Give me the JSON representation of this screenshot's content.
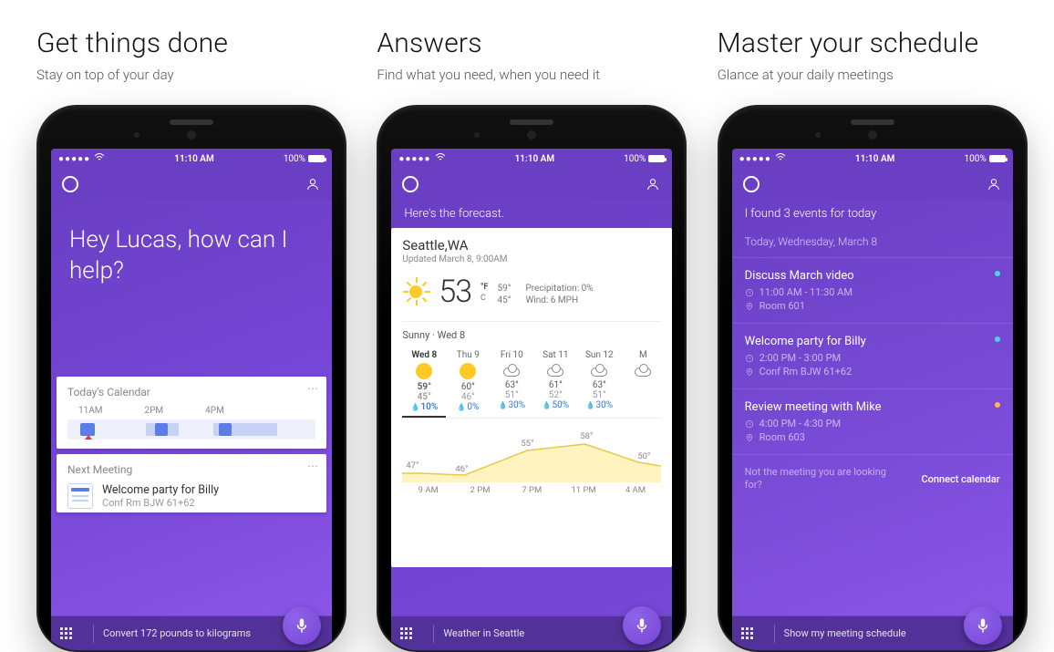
{
  "columns": {
    "c1": {
      "title": "Get things done",
      "subtitle": "Stay on top of your day"
    },
    "c2": {
      "title": "Answers",
      "subtitle": "Find what you need, when you need it"
    },
    "c3": {
      "title": "Master your schedule",
      "subtitle": "Glance at your daily meetings"
    }
  },
  "status": {
    "time": "11:10 AM",
    "battery_pct": "100%"
  },
  "screen1": {
    "greeting": "Hey Lucas, how can I help?",
    "today_calendar_label": "Today's Calendar",
    "timeline_labels": [
      "11AM",
      "2PM",
      "4PM"
    ],
    "next_meeting_label": "Next Meeting",
    "next_meeting_title": "Welcome party for Billy",
    "next_meeting_location": "Conf Rm BJW 61+62",
    "bottom_hint": "Convert 172 pounds to kilograms"
  },
  "screen2": {
    "caption": "Here's the forecast.",
    "location": "Seattle,WA",
    "updated": "Updated March 8, 9:00AM",
    "temp": "53",
    "unit_f": "°F",
    "unit_c": "C",
    "hi": "59°",
    "lo": "45°",
    "precip": "Precipitation: 0%",
    "wind": "Wind: 6 MPH",
    "condition_line": "Sunny  ·  Wed 8",
    "days": [
      {
        "label": "Wed 8",
        "icon": "sun",
        "hi": "59°",
        "lo": "45°",
        "rain": "10%"
      },
      {
        "label": "Thu 9",
        "icon": "sun",
        "hi": "60°",
        "lo": "46°",
        "rain": "0%"
      },
      {
        "label": "Fri 10",
        "icon": "cloud",
        "hi": "63°",
        "lo": "51°",
        "rain": "30%"
      },
      {
        "label": "Sat 11",
        "icon": "cloud",
        "hi": "61°",
        "lo": "52°",
        "rain": "50%"
      },
      {
        "label": "Sun 12",
        "icon": "cloud",
        "hi": "63°",
        "lo": "51°",
        "rain": "30%"
      },
      {
        "label": "M",
        "icon": "cloud",
        "hi": "",
        "lo": "",
        "rain": ""
      }
    ],
    "hourly_labels": [
      "9 AM",
      "2 PM",
      "7 PM",
      "11 PM",
      "4 AM"
    ],
    "hourly_points": [
      "47°",
      "46°",
      "55°",
      "58°",
      "50°"
    ],
    "bottom_hint": "Weather in Seattle"
  },
  "screen3": {
    "caption": "I found 3 events for today",
    "date_line": "Today, Wednesday, March 8",
    "events": [
      {
        "title": "Discuss March video",
        "time": "11:00 AM - 11:30 AM",
        "room": "Room 601",
        "dot": "#4ad7e6"
      },
      {
        "title": "Welcome party for Billy",
        "time": "2:00 PM - 3:00 PM",
        "room": "Conf Rm BJW 61+62",
        "dot": "#4ad7e6"
      },
      {
        "title": "Review meeting with Mike",
        "time": "4:00 PM - 4:30 PM",
        "room": "Room 603",
        "dot": "#ffb84d"
      }
    ],
    "footer_question": "Not the meeting you are looking for?",
    "footer_link": "Connect calendar",
    "bottom_hint": "Show my meeting schedule"
  }
}
